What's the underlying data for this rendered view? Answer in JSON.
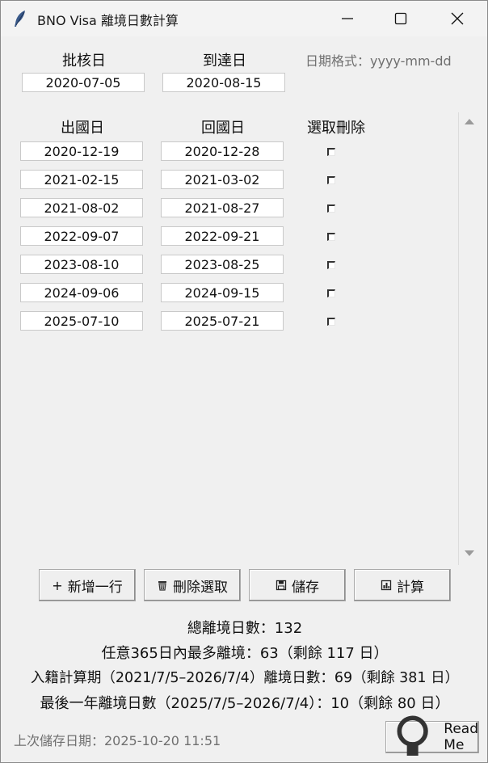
{
  "window": {
    "title": "BNO Visa 離境日數計算",
    "icon": "feather-icon",
    "controls": [
      "minimize-icon",
      "maximize-icon",
      "close-icon"
    ]
  },
  "header": {
    "approval_label": "批核日",
    "arrival_label": "到達日",
    "date_format_hint": "日期格式：yyyy-mm-dd",
    "approval_date": "2020-07-05",
    "arrival_date": "2020-08-15"
  },
  "table": {
    "columns": [
      "出國日",
      "回國日",
      "選取刪除"
    ],
    "rows": [
      {
        "depart": "2020-12-19",
        "return": "2020-12-28",
        "selected": false
      },
      {
        "depart": "2021-02-15",
        "return": "2021-03-02",
        "selected": false
      },
      {
        "depart": "2021-08-02",
        "return": "2021-08-27",
        "selected": false
      },
      {
        "depart": "2022-09-07",
        "return": "2022-09-21",
        "selected": false
      },
      {
        "depart": "2023-08-10",
        "return": "2023-08-25",
        "selected": false
      },
      {
        "depart": "2024-09-06",
        "return": "2024-09-15",
        "selected": false
      },
      {
        "depart": "2025-07-10",
        "return": "2025-07-21",
        "selected": false
      }
    ]
  },
  "toolbar": {
    "add_row": "新增一行",
    "delete_selected": "刪除選取",
    "save": "儲存",
    "calculate": "計算"
  },
  "results": {
    "total": "總離境日數：132",
    "max_365": "任意365日內最多離境：63（剩餘 117 日）",
    "naturalization": "入籍計算期（2021/7/5–2026/7/4）離境日數：69（剩餘 381 日）",
    "last_year": "最後一年離境日數（2025/7/5–2026/7/4）：10（剩餘 80 日）"
  },
  "footer": {
    "last_saved": "上次儲存日期：2025-10-20 11:51",
    "readme": "Read Me"
  }
}
